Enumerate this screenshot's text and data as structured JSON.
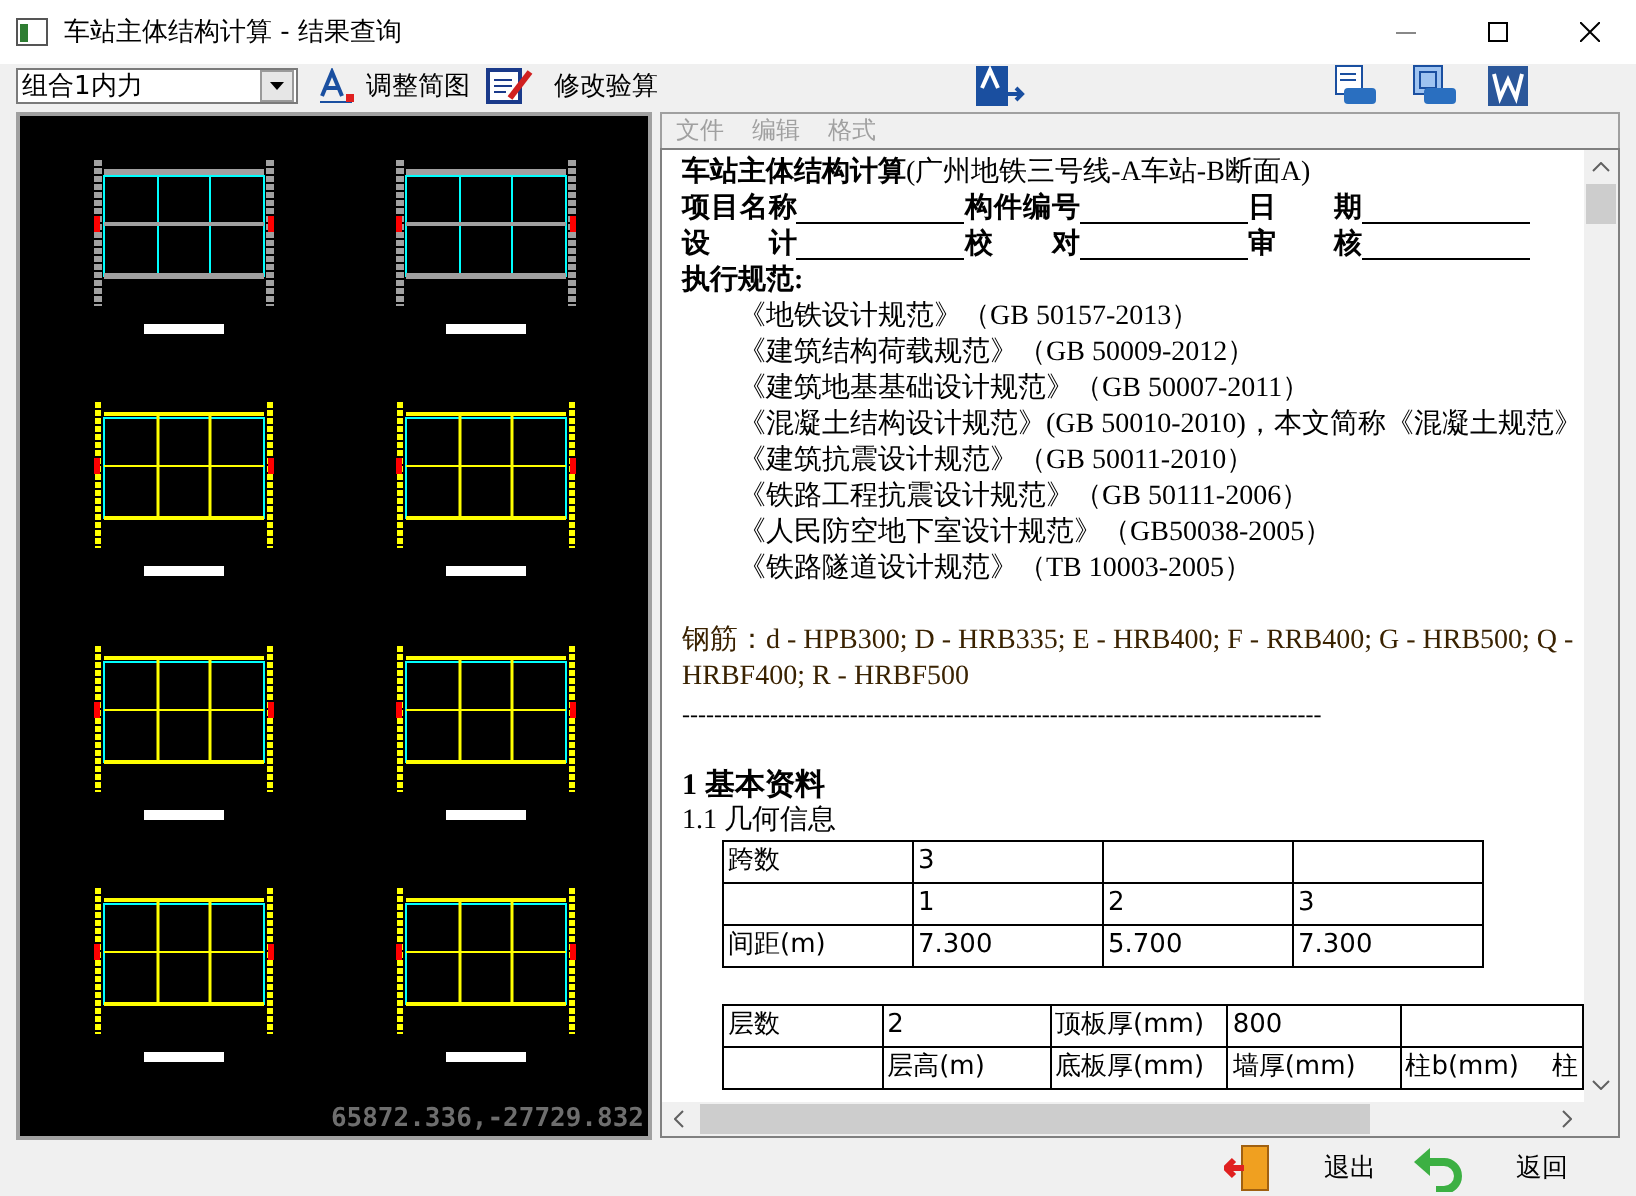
{
  "window": {
    "title": "车站主体结构计算 - 结果查询"
  },
  "toolbar": {
    "combo": {
      "value": "组合1内力"
    },
    "buttons": [
      "调整简图",
      "修改验算"
    ]
  },
  "canvas": {
    "coordinates": "65872.336,-27729.832"
  },
  "menu": [
    {
      "label": "文件",
      "disabled": true
    },
    {
      "label": "编辑",
      "disabled": true
    },
    {
      "label": "格式",
      "disabled": true
    }
  ],
  "document": {
    "title": "**车站主体结构计算**(广州地铁三号线-A车站-B断面A)",
    "form_rows": [
      [
        "项目名称",
        "构件编号",
        "日期"
      ],
      [
        "设计",
        "校对",
        "审核"
      ]
    ],
    "standards_heading": "执行规范:",
    "standards": [
      "《地铁设计规范》（GB 50157-2013）",
      "《建筑结构荷载规范》（GB 50009-2012）",
      "《建筑地基基础设计规范》（GB 50007-2011）",
      "《混凝土结构设计规范》(GB 50010-2010)，本文简称《混凝土规范》",
      "《建筑抗震设计规范》（GB 50011-2010）",
      "《铁路工程抗震设计规范》（GB 50111-2006）",
      "《人民防空地下室设计规范》（GB50038-2005）",
      "《铁路隧道设计规范》（TB 10003-2005）"
    ],
    "rebar": "钢筋：d - HPB300; D - HRB335; E - HRB400; F - RRB400; G - HRB500; Q - HRBF400; R - HRBF500",
    "divider": "--------------------------------------------------------------------------------",
    "section": "1  基本资料",
    "subsection": "1.1 几何信息",
    "tables": [
      {
        "rows": [
          [
            "跨数",
            "3",
            "",
            ""
          ],
          [
            "",
            "1",
            "2",
            "3"
          ],
          [
            "间距(m)",
            "7.300",
            "5.700",
            "7.300"
          ]
        ]
      },
      {
        "rows": [
          [
            "层数",
            "2",
            "顶板厚(mm)",
            "800",
            ""
          ],
          [
            "",
            "层高(m)",
            "底板厚(mm)",
            "墙厚(mm)",
            "柱b(mm)    柱"
          ]
        ]
      }
    ]
  },
  "footer": {
    "buttons": [
      {
        "label": "退出",
        "kind": "exit"
      },
      {
        "label": "返回",
        "kind": "back"
      }
    ]
  }
}
